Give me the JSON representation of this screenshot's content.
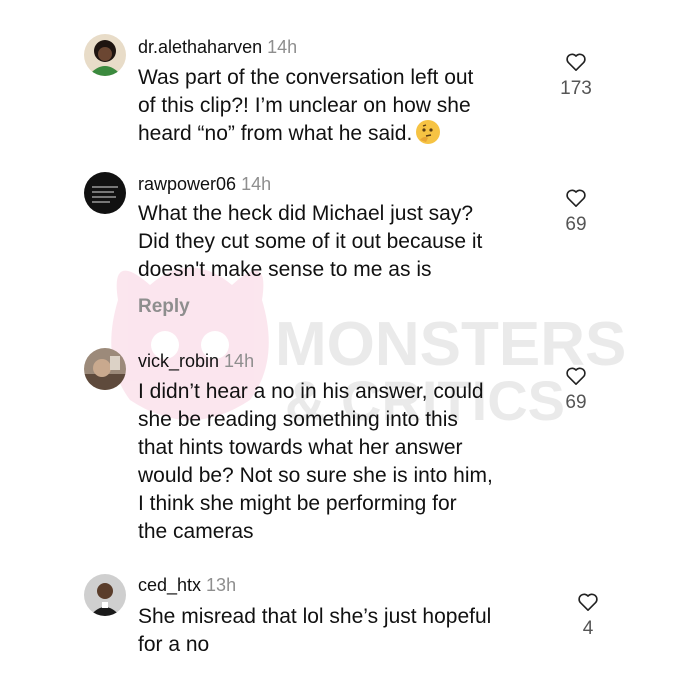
{
  "watermark": {
    "line1": "MONSTERS",
    "line2": "& CRITICS"
  },
  "comments": [
    {
      "username": "dr.alethaharven",
      "time": "14h",
      "lines": [
        "Was part of the conversation left out",
        "of this clip?! I’m unclear on how she",
        "heard “no” from what he said."
      ],
      "likes": "173",
      "avatar_color": "#3b8a3e",
      "like_icon": "heart-outline-icon",
      "emoji_icon": "thinking-face-icon"
    },
    {
      "username": "rawpower06",
      "time": "14h",
      "lines": [
        "What the heck did Michael just say?",
        "Did they cut some of it out because it",
        "doesn't make sense to me as is"
      ],
      "likes": "69",
      "reply_label": "Reply",
      "avatar_color": "#111111",
      "like_icon": "heart-outline-icon"
    },
    {
      "username": "vick_robin",
      "time": "14h",
      "lines": [
        "I didn’t hear a no in his answer, could",
        "she be reading something into this",
        "that hints towards what her answer",
        "would be? Not so sure she is into him,",
        "I think she might be performing for",
        "the cameras"
      ],
      "likes": "69",
      "avatar_color": "#8a6f5a",
      "like_icon": "heart-outline-icon"
    },
    {
      "username": "ced_htx",
      "time": "13h",
      "lines": [
        "She misread that lol she’s just hopeful",
        "for a no"
      ],
      "likes": "4",
      "avatar_color": "#6b6b6b",
      "like_icon": "heart-outline-icon"
    }
  ]
}
